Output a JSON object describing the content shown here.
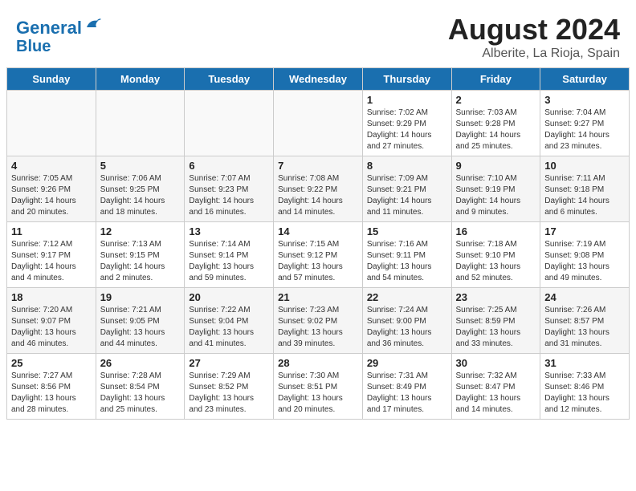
{
  "header": {
    "logo_line1": "General",
    "logo_line2": "Blue",
    "title": "August 2024",
    "subtitle": "Alberite, La Rioja, Spain"
  },
  "weekdays": [
    "Sunday",
    "Monday",
    "Tuesday",
    "Wednesday",
    "Thursday",
    "Friday",
    "Saturday"
  ],
  "weeks": [
    [
      {
        "day": "",
        "details": ""
      },
      {
        "day": "",
        "details": ""
      },
      {
        "day": "",
        "details": ""
      },
      {
        "day": "",
        "details": ""
      },
      {
        "day": "1",
        "details": "Sunrise: 7:02 AM\nSunset: 9:29 PM\nDaylight: 14 hours\nand 27 minutes."
      },
      {
        "day": "2",
        "details": "Sunrise: 7:03 AM\nSunset: 9:28 PM\nDaylight: 14 hours\nand 25 minutes."
      },
      {
        "day": "3",
        "details": "Sunrise: 7:04 AM\nSunset: 9:27 PM\nDaylight: 14 hours\nand 23 minutes."
      }
    ],
    [
      {
        "day": "4",
        "details": "Sunrise: 7:05 AM\nSunset: 9:26 PM\nDaylight: 14 hours\nand 20 minutes."
      },
      {
        "day": "5",
        "details": "Sunrise: 7:06 AM\nSunset: 9:25 PM\nDaylight: 14 hours\nand 18 minutes."
      },
      {
        "day": "6",
        "details": "Sunrise: 7:07 AM\nSunset: 9:23 PM\nDaylight: 14 hours\nand 16 minutes."
      },
      {
        "day": "7",
        "details": "Sunrise: 7:08 AM\nSunset: 9:22 PM\nDaylight: 14 hours\nand 14 minutes."
      },
      {
        "day": "8",
        "details": "Sunrise: 7:09 AM\nSunset: 9:21 PM\nDaylight: 14 hours\nand 11 minutes."
      },
      {
        "day": "9",
        "details": "Sunrise: 7:10 AM\nSunset: 9:19 PM\nDaylight: 14 hours\nand 9 minutes."
      },
      {
        "day": "10",
        "details": "Sunrise: 7:11 AM\nSunset: 9:18 PM\nDaylight: 14 hours\nand 6 minutes."
      }
    ],
    [
      {
        "day": "11",
        "details": "Sunrise: 7:12 AM\nSunset: 9:17 PM\nDaylight: 14 hours\nand 4 minutes."
      },
      {
        "day": "12",
        "details": "Sunrise: 7:13 AM\nSunset: 9:15 PM\nDaylight: 14 hours\nand 2 minutes."
      },
      {
        "day": "13",
        "details": "Sunrise: 7:14 AM\nSunset: 9:14 PM\nDaylight: 13 hours\nand 59 minutes."
      },
      {
        "day": "14",
        "details": "Sunrise: 7:15 AM\nSunset: 9:12 PM\nDaylight: 13 hours\nand 57 minutes."
      },
      {
        "day": "15",
        "details": "Sunrise: 7:16 AM\nSunset: 9:11 PM\nDaylight: 13 hours\nand 54 minutes."
      },
      {
        "day": "16",
        "details": "Sunrise: 7:18 AM\nSunset: 9:10 PM\nDaylight: 13 hours\nand 52 minutes."
      },
      {
        "day": "17",
        "details": "Sunrise: 7:19 AM\nSunset: 9:08 PM\nDaylight: 13 hours\nand 49 minutes."
      }
    ],
    [
      {
        "day": "18",
        "details": "Sunrise: 7:20 AM\nSunset: 9:07 PM\nDaylight: 13 hours\nand 46 minutes."
      },
      {
        "day": "19",
        "details": "Sunrise: 7:21 AM\nSunset: 9:05 PM\nDaylight: 13 hours\nand 44 minutes."
      },
      {
        "day": "20",
        "details": "Sunrise: 7:22 AM\nSunset: 9:04 PM\nDaylight: 13 hours\nand 41 minutes."
      },
      {
        "day": "21",
        "details": "Sunrise: 7:23 AM\nSunset: 9:02 PM\nDaylight: 13 hours\nand 39 minutes."
      },
      {
        "day": "22",
        "details": "Sunrise: 7:24 AM\nSunset: 9:00 PM\nDaylight: 13 hours\nand 36 minutes."
      },
      {
        "day": "23",
        "details": "Sunrise: 7:25 AM\nSunset: 8:59 PM\nDaylight: 13 hours\nand 33 minutes."
      },
      {
        "day": "24",
        "details": "Sunrise: 7:26 AM\nSunset: 8:57 PM\nDaylight: 13 hours\nand 31 minutes."
      }
    ],
    [
      {
        "day": "25",
        "details": "Sunrise: 7:27 AM\nSunset: 8:56 PM\nDaylight: 13 hours\nand 28 minutes."
      },
      {
        "day": "26",
        "details": "Sunrise: 7:28 AM\nSunset: 8:54 PM\nDaylight: 13 hours\nand 25 minutes."
      },
      {
        "day": "27",
        "details": "Sunrise: 7:29 AM\nSunset: 8:52 PM\nDaylight: 13 hours\nand 23 minutes."
      },
      {
        "day": "28",
        "details": "Sunrise: 7:30 AM\nSunset: 8:51 PM\nDaylight: 13 hours\nand 20 minutes."
      },
      {
        "day": "29",
        "details": "Sunrise: 7:31 AM\nSunset: 8:49 PM\nDaylight: 13 hours\nand 17 minutes."
      },
      {
        "day": "30",
        "details": "Sunrise: 7:32 AM\nSunset: 8:47 PM\nDaylight: 13 hours\nand 14 minutes."
      },
      {
        "day": "31",
        "details": "Sunrise: 7:33 AM\nSunset: 8:46 PM\nDaylight: 13 hours\nand 12 minutes."
      }
    ]
  ]
}
